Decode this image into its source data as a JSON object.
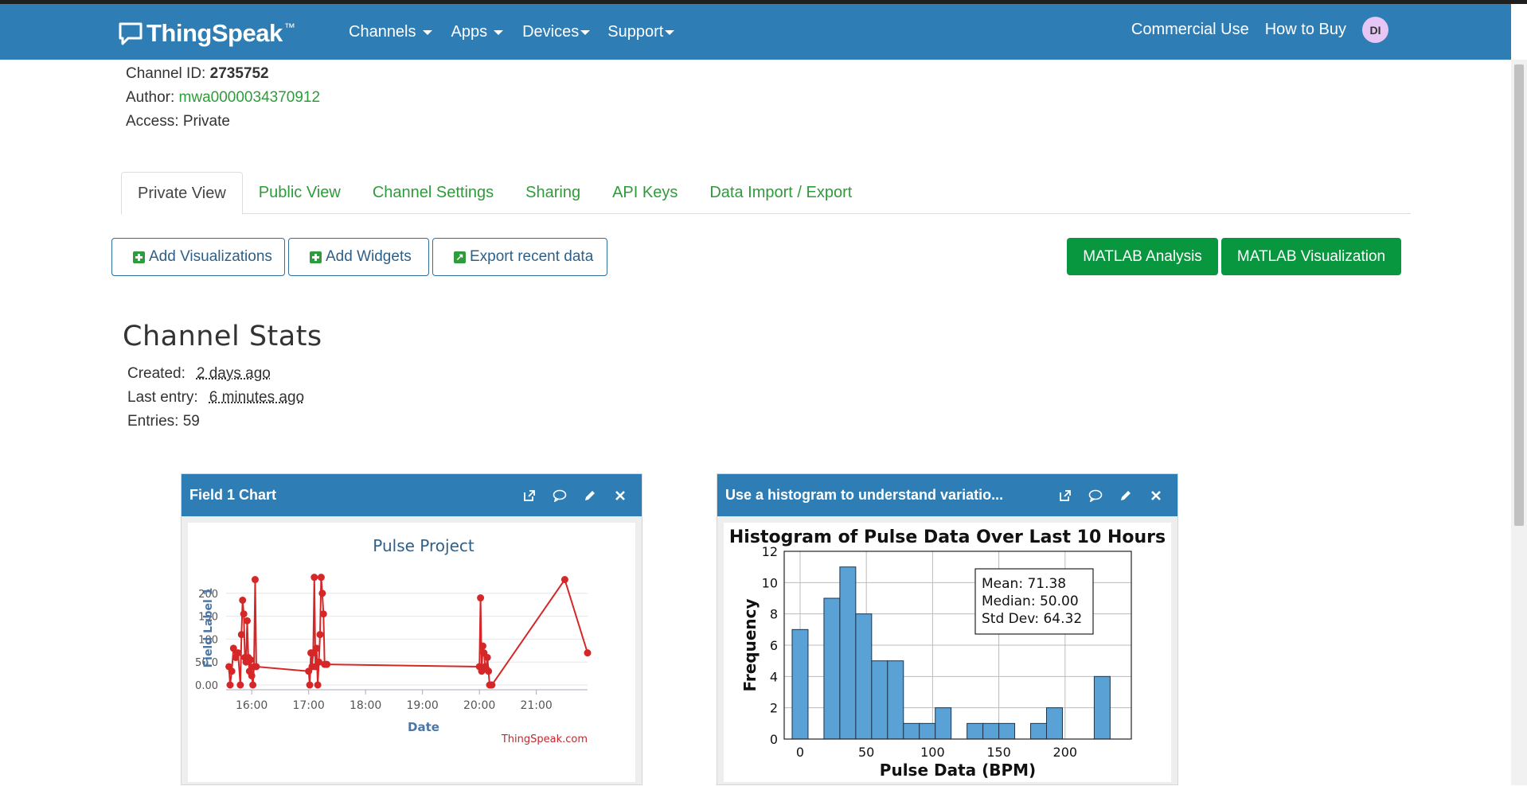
{
  "brand": {
    "name": "ThingSpeak",
    "tm": "™"
  },
  "nav": {
    "left": [
      "Channels",
      "Apps",
      "Devices",
      "Support"
    ],
    "right": [
      "Commercial Use",
      "How to Buy"
    ],
    "avatar": "DI"
  },
  "channel": {
    "id_label": "Channel ID:",
    "id": "2735752",
    "author_label": "Author:",
    "author": "mwa0000034370912",
    "access_label": "Access:",
    "access": "Private"
  },
  "tabs": [
    "Private View",
    "Public View",
    "Channel Settings",
    "Sharing",
    "API Keys",
    "Data Import / Export"
  ],
  "buttons": {
    "add_visualizations": "Add Visualizations",
    "add_widgets": "Add Widgets",
    "export_recent": "Export recent data",
    "matlab_analysis": "MATLAB Analysis",
    "matlab_visualization": "MATLAB Visualization"
  },
  "stats": {
    "title": "Channel Stats",
    "created_label": "Created:",
    "created": "2 days ago",
    "last_entry_label": "Last entry:",
    "last_entry": "6 minutes ago",
    "entries_label": "Entries:",
    "entries": "59"
  },
  "panels": {
    "field1": {
      "title": "Field 1 Chart"
    },
    "histogram": {
      "title": "Use a histogram to understand variatio..."
    }
  },
  "colors": {
    "nav": "#2f7db5",
    "green": "#08973e",
    "link": "#2e9c3a",
    "line": "#d62728",
    "hist": "#5aa2d6"
  },
  "chart_data": [
    {
      "type": "line",
      "title": "Pulse Project",
      "xlabel": "Date",
      "ylabel": "Field Label 1",
      "credit": "ThingSpeak.com",
      "x_ticks": [
        "16:00",
        "17:00",
        "18:00",
        "19:00",
        "20:00",
        "21:00"
      ],
      "y_ticks": [
        "0.00",
        "50.0",
        "100",
        "150",
        "200"
      ],
      "ylim": [
        0,
        250
      ],
      "x_range_hours": [
        15.55,
        21.9
      ],
      "series": [
        {
          "x": [
            15.6,
            15.62,
            15.65,
            15.68,
            15.72,
            15.76,
            15.8,
            15.82,
            15.84,
            15.86,
            15.88,
            15.9,
            15.92,
            15.94,
            15.96,
            15.98,
            16.0,
            16.02,
            16.04,
            16.06,
            16.08,
            17.0,
            17.02,
            17.04,
            17.06,
            17.08,
            17.1,
            17.12,
            17.14,
            17.16,
            17.18,
            17.2,
            17.22,
            17.24,
            17.26,
            17.28,
            17.3,
            17.32,
            20.0,
            20.02,
            20.04,
            20.06,
            20.08,
            20.1,
            20.12,
            20.14,
            20.16,
            20.18,
            20.2,
            20.22,
            21.5,
            21.9
          ],
          "y": [
            40,
            0,
            30,
            80,
            60,
            70,
            0,
            110,
            185,
            155,
            60,
            50,
            140,
            60,
            30,
            55,
            20,
            0,
            40,
            230,
            40,
            30,
            0,
            70,
            40,
            70,
            235,
            40,
            80,
            0,
            50,
            110,
            235,
            200,
            155,
            45,
            45,
            45,
            40,
            190,
            30,
            85,
            70,
            40,
            35,
            60,
            30,
            0,
            0,
            0,
            230,
            70
          ]
        }
      ]
    },
    {
      "type": "bar",
      "title": "Histogram of Pulse Data Over Last 10 Hours",
      "xlabel": "Pulse Data (BPM)",
      "ylabel": "Frequency",
      "x_ticks": [
        "0",
        "50",
        "100",
        "150",
        "200"
      ],
      "y_ticks": [
        "0",
        "2",
        "4",
        "6",
        "8",
        "10",
        "12"
      ],
      "xlim": [
        -12,
        250
      ],
      "ylim": [
        0,
        12
      ],
      "bin_width": 12,
      "bins": [
        0,
        12,
        24,
        36,
        48,
        60,
        72,
        84,
        96,
        108,
        120,
        132,
        144,
        156,
        168,
        180,
        192,
        204,
        216,
        228
      ],
      "counts": [
        7,
        0,
        9,
        11,
        8,
        5,
        5,
        1,
        1,
        2,
        0,
        1,
        1,
        1,
        0,
        1,
        2,
        0,
        0,
        4
      ],
      "annotation": [
        "Mean: 71.38",
        "Median: 50.00",
        "Std Dev: 64.32"
      ]
    }
  ]
}
